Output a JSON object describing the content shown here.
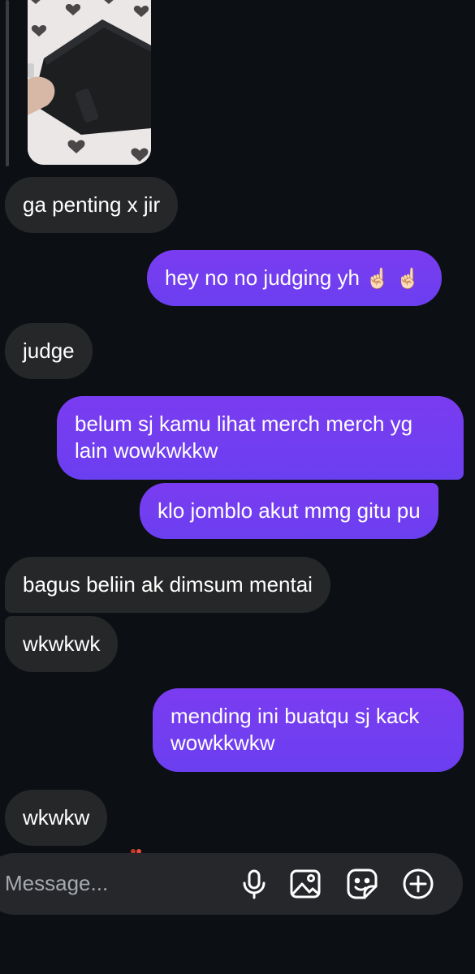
{
  "messages": [
    {
      "side": "received",
      "text": "ga penting x jir"
    },
    {
      "side": "sent",
      "text": "hey no no judging yh",
      "emoji": "☝🏻 ☝🏻"
    },
    {
      "side": "received",
      "text": "judge"
    },
    {
      "side": "sent",
      "line1": "belum sj kamu lihat merch merch yg",
      "line2": "lain wowkwkkw"
    },
    {
      "side": "sent",
      "text": "klo jomblo akut mmg gitu pu"
    },
    {
      "side": "received",
      "text": "bagus beliin ak dimsum mentai"
    },
    {
      "side": "received",
      "text": "wkwkwk"
    },
    {
      "side": "sent",
      "line1": "mending ini buatqu sj kack",
      "line2": "wowkkwkw"
    },
    {
      "side": "received",
      "text": "wkwkw"
    }
  ],
  "composer": {
    "placeholder": "Message...",
    "icons": [
      "microphone-icon",
      "image-icon",
      "sticker-icon",
      "plus-circle-icon"
    ]
  },
  "colors": {
    "background": "#0c1014",
    "received_bubble": "#262729",
    "sent_bubble": "#7040f0"
  }
}
